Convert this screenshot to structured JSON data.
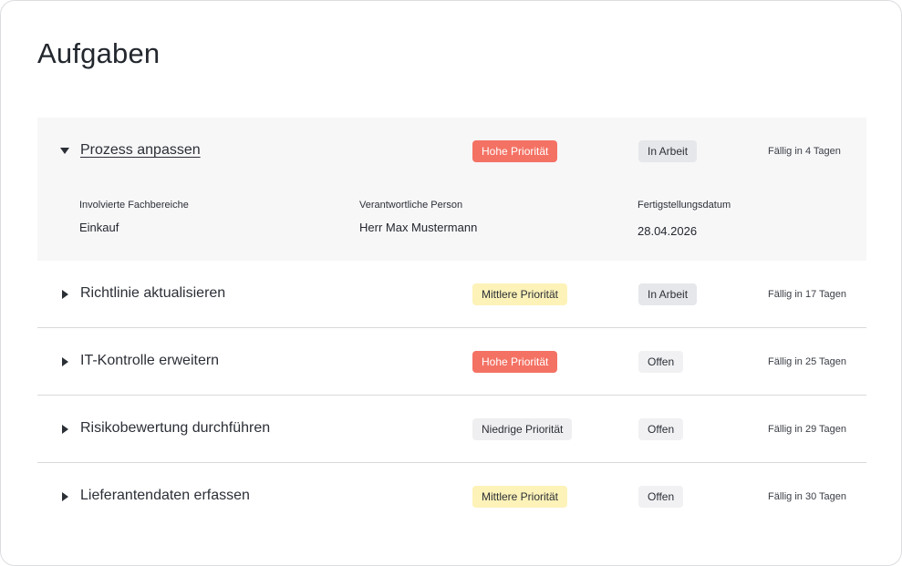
{
  "page": {
    "title": "Aufgaben"
  },
  "tasks": [
    {
      "name": "Prozess anpassen",
      "priority": "Hohe Priorität",
      "status": "In Arbeit",
      "due": "Fällig in 4 Tagen",
      "expanded": true,
      "details": {
        "areas_label": "Involvierte Fachbereiche",
        "areas_value": "Einkauf",
        "person_label": "Verantwortliche Person",
        "person_value": "Herr Max Mustermann",
        "date_label": "Fertigstellungsdatum",
        "date_value": "28.04.2026"
      }
    },
    {
      "name": "Richtlinie aktualisieren",
      "priority": "Mittlere Priorität",
      "status": "In Arbeit",
      "due": "Fällig in 17 Tagen",
      "expanded": false
    },
    {
      "name": "IT-Kontrolle erweitern",
      "priority": "Hohe Priorität",
      "status": "Offen",
      "due": "Fällig in 25 Tagen",
      "expanded": false
    },
    {
      "name": "Risikobewertung durchführen",
      "priority": "Niedrige Priorität",
      "status": "Offen",
      "due": "Fällig in 29 Tagen",
      "expanded": false
    },
    {
      "name": "Lieferantendaten erfassen",
      "priority": "Mittlere Priorität",
      "status": "Offen",
      "due": "Fällig in 30 Tagen",
      "expanded": false
    }
  ],
  "colors": {
    "priority_high": "#f47264",
    "priority_medium": "#fdf2b8",
    "priority_low": "#efeff1",
    "status_in_progress": "#e6e7ea",
    "status_open": "#f1f1f3",
    "expanded_row_bg": "#f7f7f8"
  },
  "icons": {
    "expanded": "caret-down-icon",
    "collapsed": "caret-right-icon"
  }
}
